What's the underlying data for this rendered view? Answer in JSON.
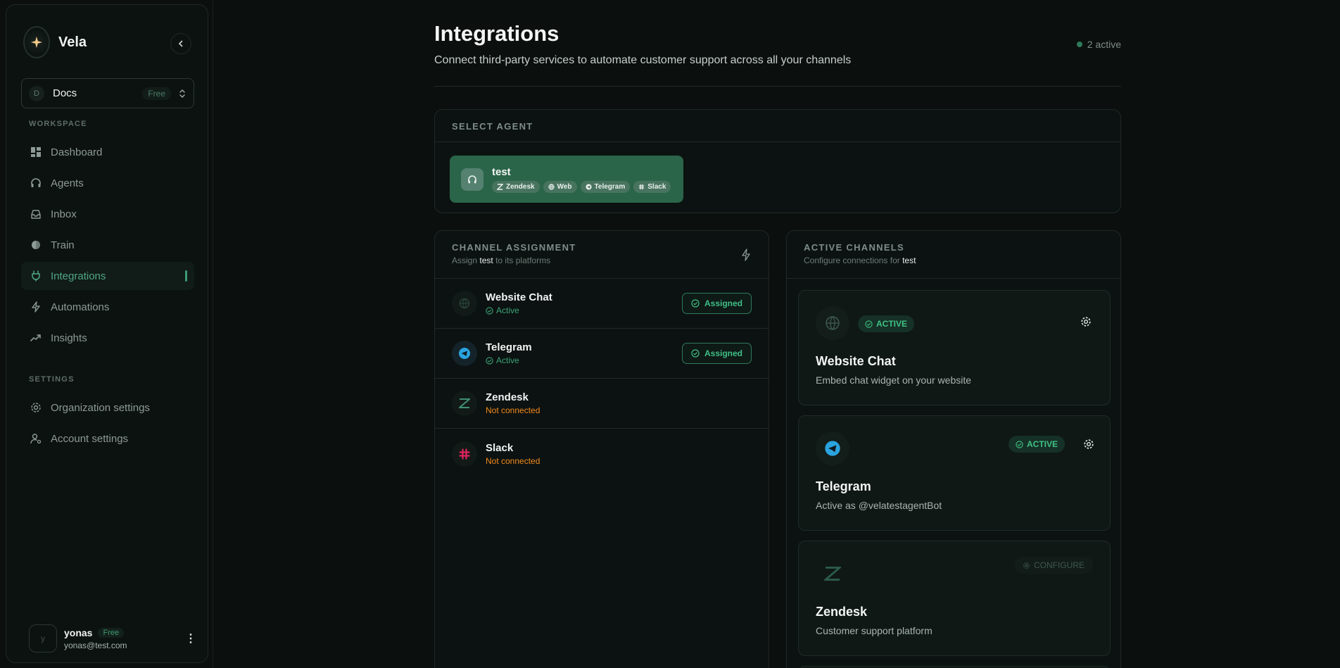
{
  "sidebar": {
    "brand": "Vela",
    "workspace": {
      "initial": "D",
      "name": "Docs",
      "plan": "Free"
    },
    "workspace_label": "WORKSPACE",
    "settings_label": "SETTINGS",
    "nav": [
      {
        "label": "Dashboard",
        "icon": "grid-icon"
      },
      {
        "label": "Agents",
        "icon": "headset-icon"
      },
      {
        "label": "Inbox",
        "icon": "inbox-icon"
      },
      {
        "label": "Train",
        "icon": "brain-icon"
      },
      {
        "label": "Integrations",
        "icon": "plug-icon",
        "active": true
      },
      {
        "label": "Automations",
        "icon": "bolt-icon"
      },
      {
        "label": "Insights",
        "icon": "trend-icon"
      }
    ],
    "settings": [
      {
        "label": "Organization settings",
        "icon": "gear-icon"
      },
      {
        "label": "Account settings",
        "icon": "user-gear-icon"
      }
    ],
    "user": {
      "initial": "y",
      "name": "yonas",
      "plan": "Free",
      "email": "yonas@test.com"
    }
  },
  "header": {
    "title": "Integrations",
    "subtitle": "Connect third-party services to automate customer support across all your channels",
    "active_count": "2 active"
  },
  "select_agent": {
    "title": "SELECT AGENT",
    "agent": {
      "name": "test",
      "chips": [
        "Zendesk",
        "Web",
        "Telegram",
        "Slack"
      ]
    }
  },
  "channel_assignment": {
    "title": "CHANNEL ASSIGNMENT",
    "desc_prefix": "Assign",
    "desc_agent": "test",
    "desc_suffix": "to its platforms",
    "rows": [
      {
        "name": "Website Chat",
        "status": "Active",
        "button": "Assigned"
      },
      {
        "name": "Telegram",
        "status": "Active",
        "button": "Assigned"
      },
      {
        "name": "Zendesk",
        "status": "Not connected"
      },
      {
        "name": "Slack",
        "status": "Not connected"
      }
    ]
  },
  "active_channels": {
    "title": "ACTIVE CHANNELS",
    "desc_prefix": "Configure connections for",
    "desc_agent": "test",
    "cards": [
      {
        "name": "Website Chat",
        "desc": "Embed chat widget on your website",
        "badge": "ACTIVE"
      },
      {
        "name": "Telegram",
        "desc": "Active as @velatestagentBot",
        "badge": "ACTIVE"
      },
      {
        "name": "Zendesk",
        "desc": "Customer support platform",
        "badge": "CONFIGURE"
      }
    ]
  },
  "colors": {
    "accent": "#2f7a5c",
    "active_green": "#3aa477",
    "warning_orange": "#f28a1c",
    "background": "#0b0f0e"
  }
}
